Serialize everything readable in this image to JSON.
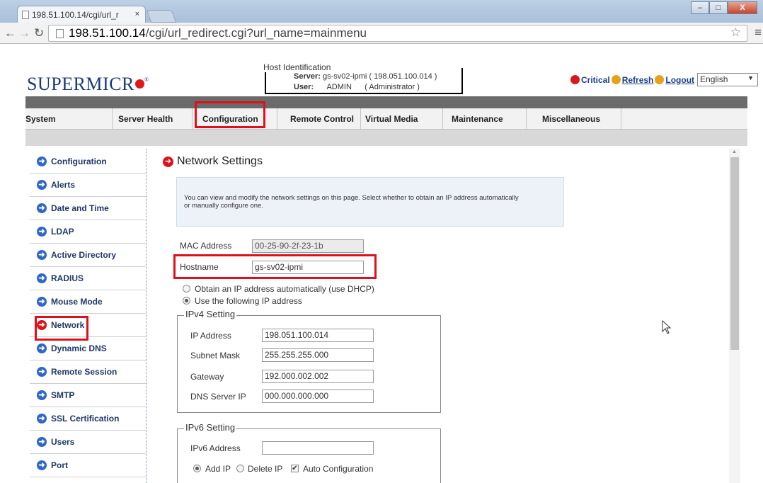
{
  "browser": {
    "tab_title": "198.51.100.14/cgi/url_r",
    "tab_close": "×",
    "url_host": "198.51.100.14",
    "url_path": "/cgi/url_redirect.cgi?url_name=mainmenu",
    "window_buttons": [
      "–",
      "□",
      "X"
    ]
  },
  "brand": {
    "logo_text": "SUPERMICR",
    "reg": "®"
  },
  "host_identification": {
    "title": "Host Identification",
    "server_label": "Server:",
    "server_value": "gs-sv02-ipmi  ( 198.051.100.014 )",
    "user_label": "User:",
    "user_value": "ADMIN",
    "user_role": "( Administrator )"
  },
  "top_links": {
    "critical": "Critical",
    "refresh": "Refresh",
    "logout": "Logout",
    "language": "English"
  },
  "nav": {
    "items": [
      "System",
      "Server Health",
      "Configuration",
      "Remote Control",
      "Virtual Media",
      "Maintenance",
      "Miscellaneous"
    ],
    "active": "Configuration"
  },
  "sidebar": {
    "items": [
      "Configuration",
      "Alerts",
      "Date and Time",
      "LDAP",
      "Active Directory",
      "RADIUS",
      "Mouse Mode",
      "Network",
      "Dynamic DNS",
      "Remote Session",
      "SMTP",
      "SSL Certification",
      "Users",
      "Port"
    ],
    "active": "Network"
  },
  "main": {
    "title": "Network Settings",
    "info_line1": "You can view and modify the network settings on this page. Select whether to obtain an IP address automatically",
    "info_line2": "or manually configure one.",
    "mac_label": "MAC Address",
    "mac_value": "00-25-90-2f-23-1b",
    "hostname_label": "Hostname",
    "hostname_value": "gs-sv02-ipmi",
    "dhcp_label": "Obtain an IP address automatically (use DHCP)",
    "static_label": "Use the following IP address",
    "ipv4": {
      "legend": "IPv4 Setting",
      "ip_label": "IP Address",
      "ip_value": "198.051.100.014",
      "subnet_label": "Subnet Mask",
      "subnet_value": "255.255.255.000",
      "gateway_label": "Gateway",
      "gateway_value": "192.000.002.002",
      "dns_label": "DNS Server IP",
      "dns_value": "000.000.000.000"
    },
    "ipv6": {
      "legend": "IPv6 Setting",
      "address_label": "IPv6 Address",
      "address_value": "",
      "add_ip_label": "Add IP",
      "delete_ip_label": "Delete IP",
      "auto_config_label": "Auto Configuration"
    }
  },
  "colors": {
    "highlight": "#e0101a",
    "link": "#1a3e8c",
    "icon_blue": "#2f67c8"
  }
}
